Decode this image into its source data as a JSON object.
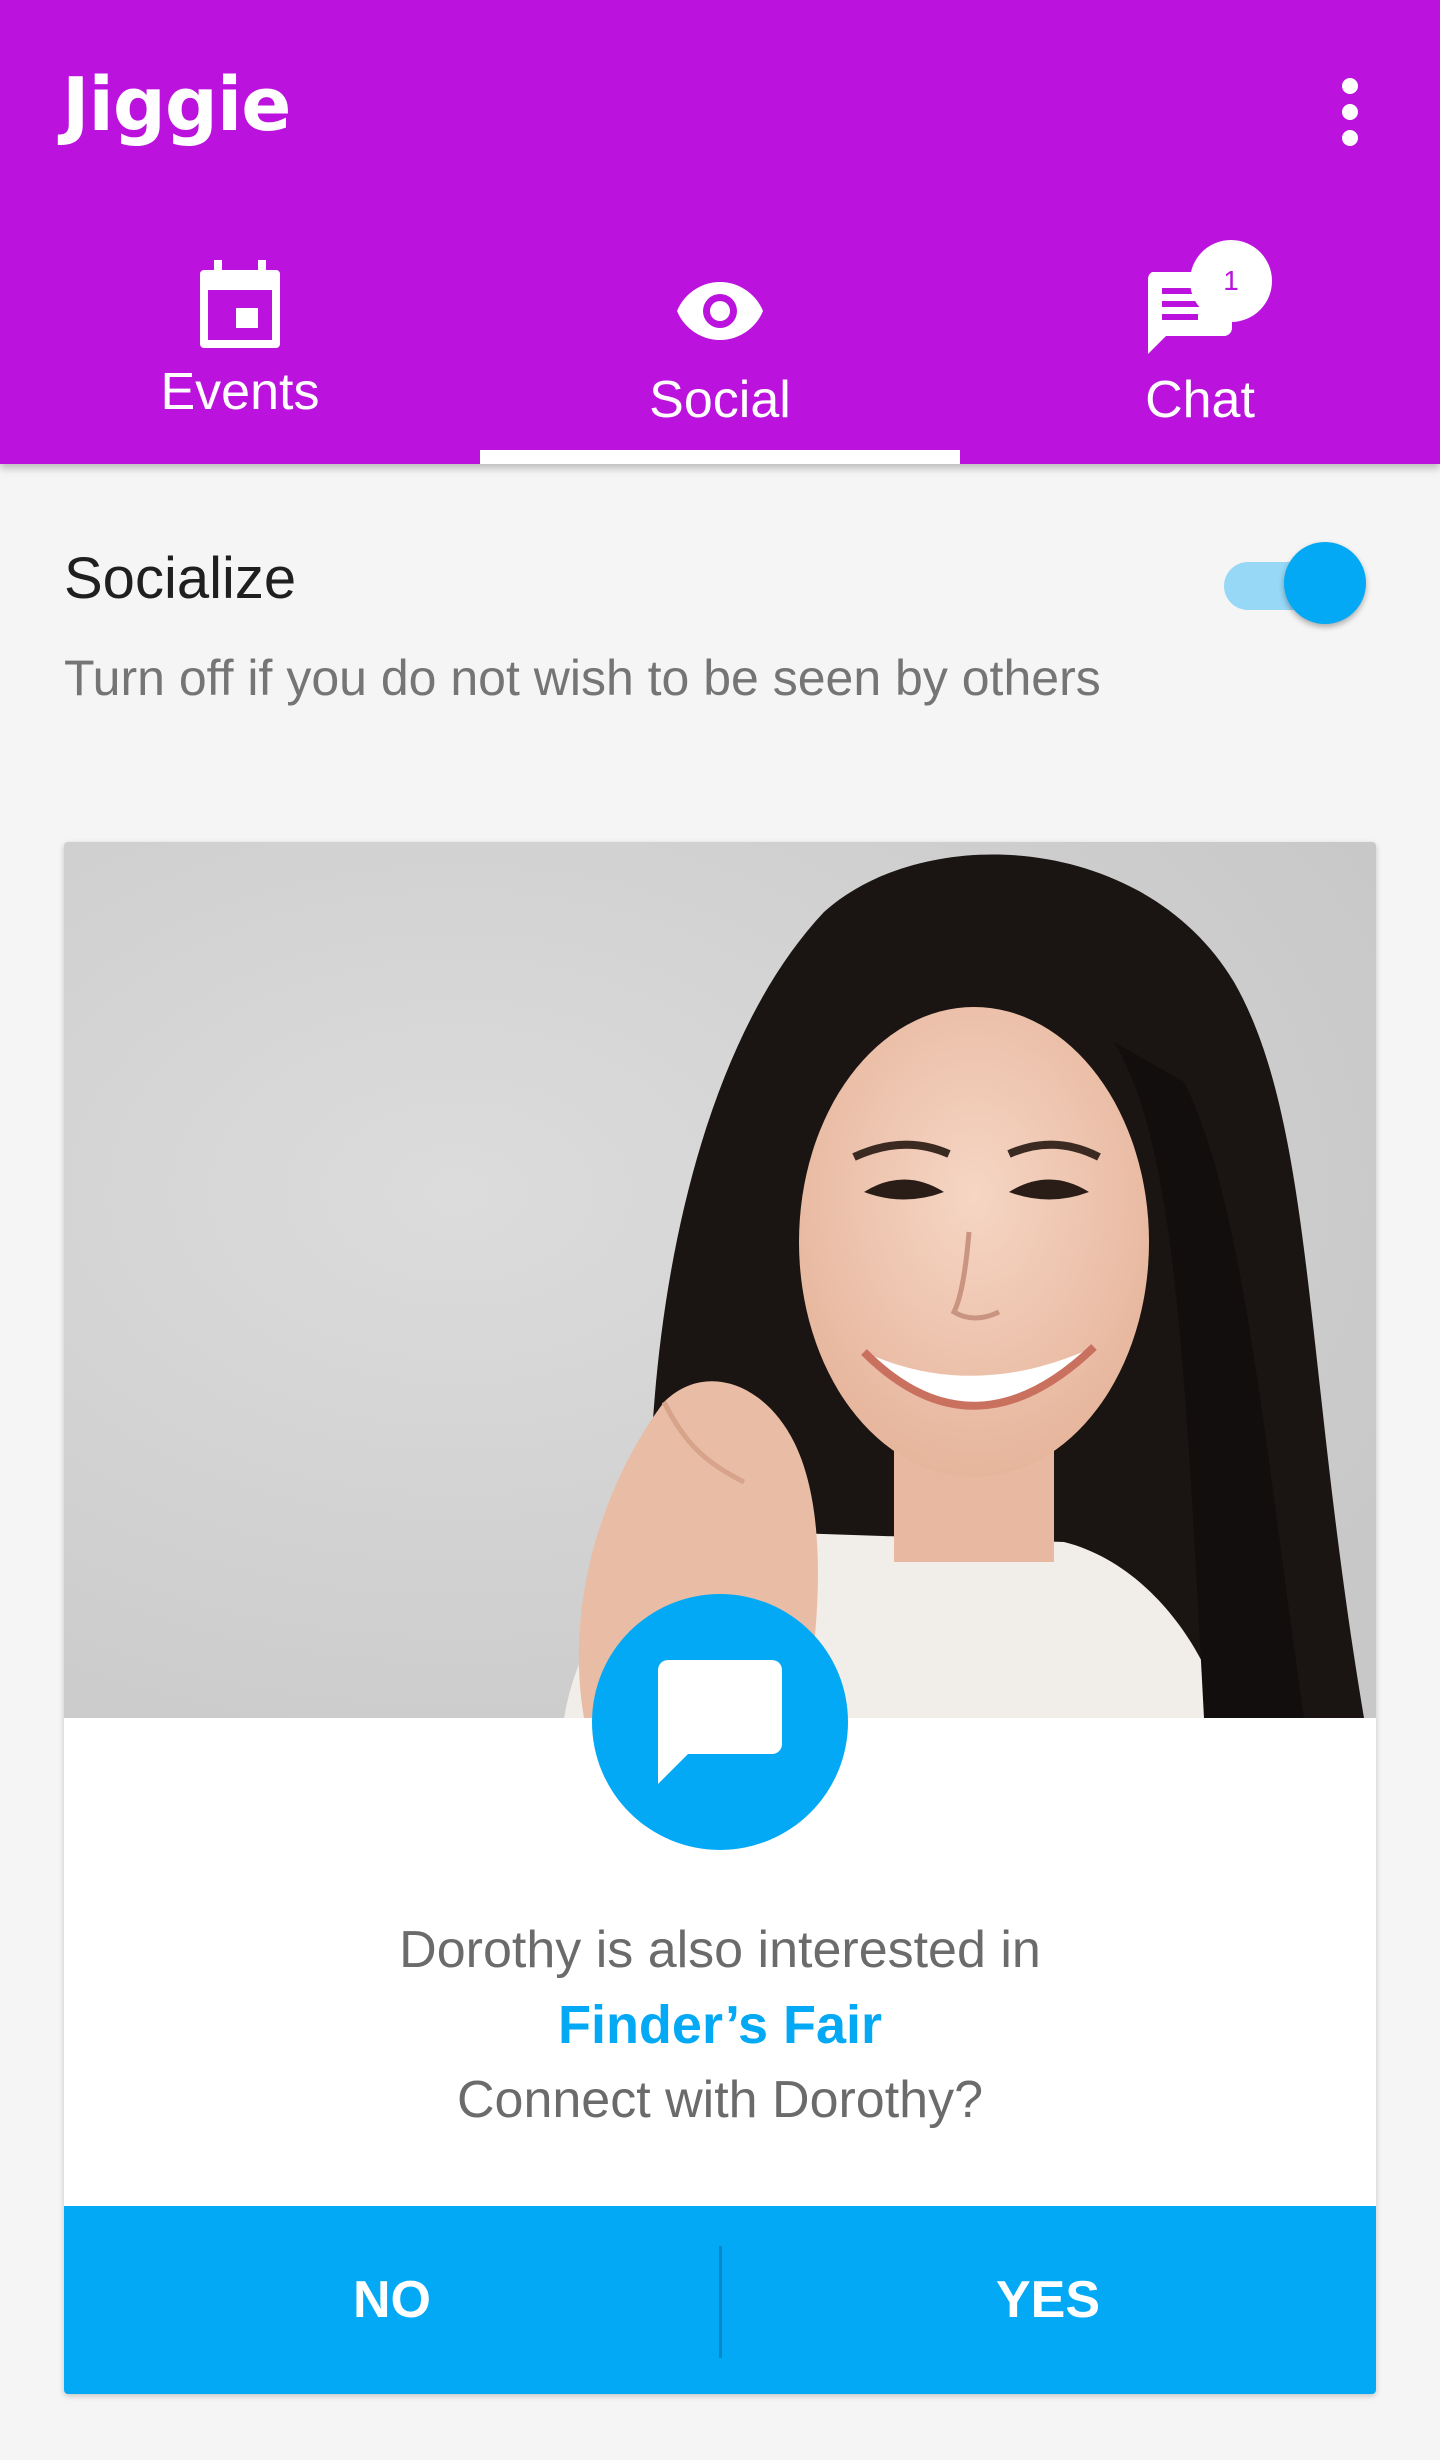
{
  "app": {
    "name": "Jiggie"
  },
  "header": {
    "logo_text": "Jiggie",
    "menu_icon": "more-vert-icon"
  },
  "tabs": [
    {
      "label": "Events",
      "icon": "calendar-icon",
      "selected": false
    },
    {
      "label": "Social",
      "icon": "eye-icon",
      "selected": true
    },
    {
      "label": "Chat",
      "icon": "chat-icon",
      "selected": false,
      "badge": "1"
    }
  ],
  "socialize": {
    "title": "Socialize",
    "description": "Turn off if you do not wish to be seen by others",
    "toggle_on": true
  },
  "card": {
    "photo": "profile-photo",
    "message_icon": "message-icon",
    "line1": "Dorothy is also interested in",
    "event_name": "Finder’s Fair",
    "line3": "Connect with Dorothy?",
    "no_label": "NO",
    "yes_label": "YES"
  },
  "colors": {
    "app_bar": "#bb12dd",
    "accent": "#03a9f4",
    "toggle_track": "#97d8f6",
    "background": "#f5f5f5"
  }
}
